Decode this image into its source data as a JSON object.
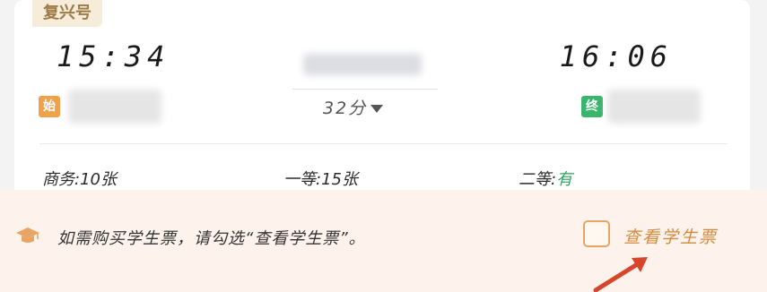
{
  "train": {
    "type_label": "复兴号",
    "departure_time": "15:34",
    "arrival_time": "16:06",
    "duration": "32分",
    "start_badge": "始",
    "end_badge": "终"
  },
  "seats": [
    {
      "label": "商务:",
      "value": "10张"
    },
    {
      "label": "一等:",
      "value": "15张"
    },
    {
      "label": "二等:",
      "value": "有"
    }
  ],
  "notice": {
    "text": "如需购买学生票，请勾选“查看学生票”。",
    "checkbox_label": "查看学生票"
  },
  "colors": {
    "tag_bg": "#f6ecd9",
    "tag_text": "#9c7a48",
    "start_badge": "#f0a24a",
    "end_badge": "#39b56c",
    "available_green": "#2fa35c",
    "notice_bg": "#fdf3ec",
    "accent_orange": "#e8a463",
    "arrow_red": "#d8452b"
  },
  "icons": {
    "notice_icon": "graduation-cap-icon",
    "duration_toggle": "caret-down-icon",
    "pointer": "arrow-icon"
  }
}
